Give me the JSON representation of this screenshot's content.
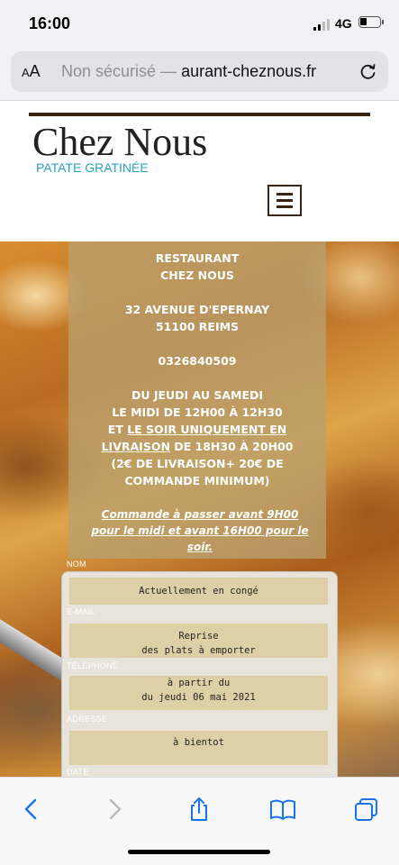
{
  "status_bar": {
    "time": "16:00",
    "network": "4G"
  },
  "address_bar": {
    "aa_label": "A",
    "aa_label_large": "A",
    "security_text": "Non sécurisé — ",
    "domain_text": "aurant-cheznous.fr"
  },
  "site": {
    "title": "Chez Nous",
    "subtitle": "PATATE GRATINÉE"
  },
  "info": {
    "name_line1": "RESTAURANT",
    "name_line2": "CHEZ NOUS",
    "address_line1": "32 AVENUE D'EPERNAY",
    "address_line2": "51100 REIMS",
    "phone": "0326840509",
    "hours_line1": "DU JEUDI AU SAMEDI",
    "hours_line2": "LE MIDI DE 12H00 À 12H30",
    "hours_line3_pre": "ET ",
    "hours_line3_link": "LE SOIR UNIQUEMENT EN",
    "hours_line4_link": "LIVRAISON",
    "hours_line4_post": " DE 18H30 À 20H00",
    "delivery_line1": "(2€ DE LIVRAISON+ 20€ DE",
    "delivery_line2": "COMMANDE MINIMUM)",
    "order_note": "Commande à passer avant 9H00 pour le midi et avant 16H00 pour le soir."
  },
  "form_labels": {
    "name": "NOM",
    "email": "E-MAIL",
    "phone": "TÉLÉPHONE",
    "address": "ADRESSE",
    "date": "DATE"
  },
  "popup": {
    "closed_text": "Actuellement en congé",
    "reopen_line1": "Reprise",
    "reopen_line2": "des plats à emporter",
    "reopen_line3": "à partir du",
    "reopen_line4": "du jeudi 06 mai 2021",
    "bye_text": "à bientot"
  },
  "colors": {
    "accent_blue": "#27a3c5",
    "header_brown": "#3a2416",
    "ios_blue": "#1a73e8"
  },
  "toolbar_icons": [
    "back-icon",
    "forward-icon",
    "share-icon",
    "bookmarks-icon",
    "tabs-icon"
  ]
}
